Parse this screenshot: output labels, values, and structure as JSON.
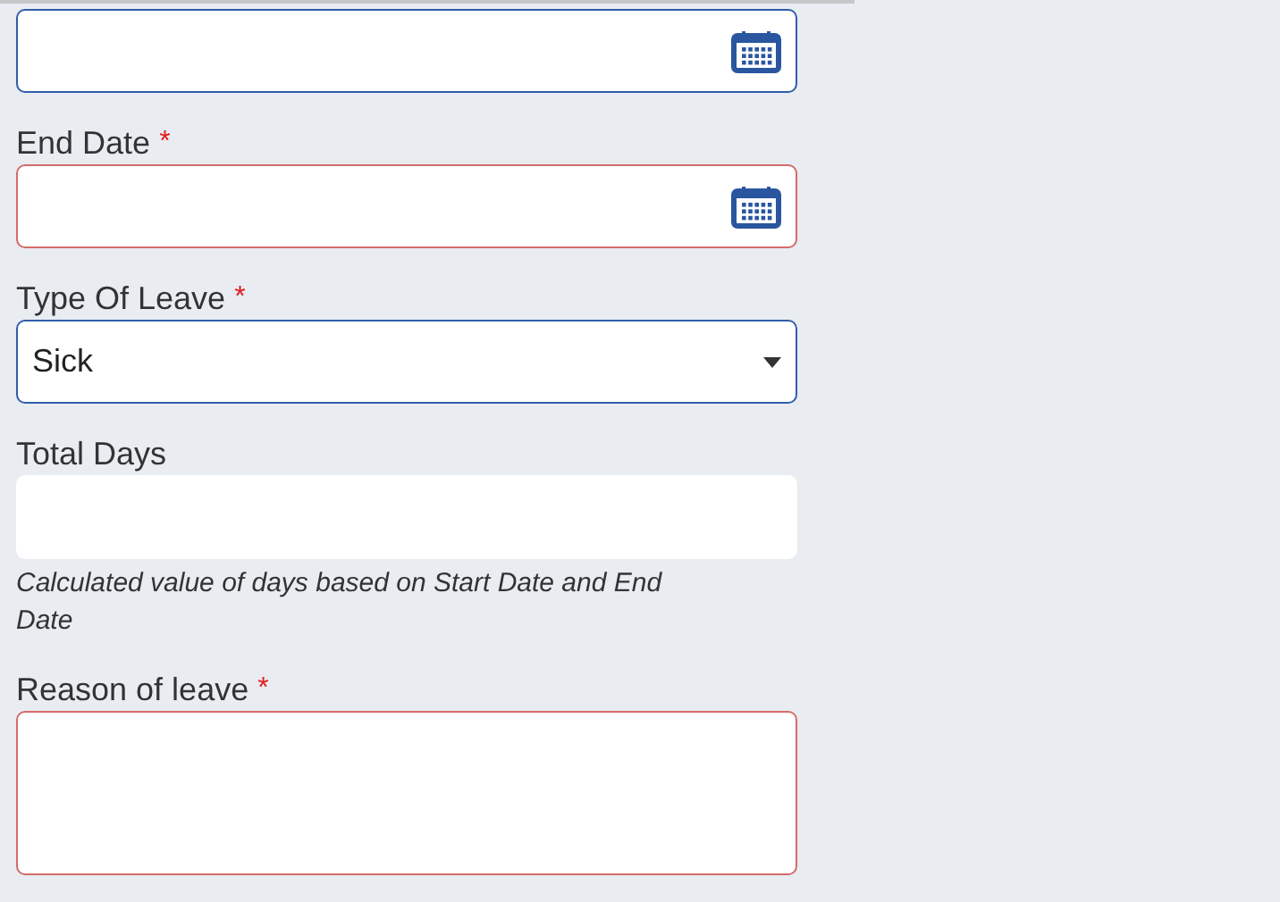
{
  "fields": [
    {
      "kind": "date",
      "invalid": false,
      "focused": true
    },
    {
      "kind": "date",
      "label": "End Date",
      "required": true,
      "invalid": true
    },
    {
      "kind": "select",
      "label": "Type Of Leave",
      "required": true,
      "invalid": false,
      "focused": true,
      "value": "Sick"
    },
    {
      "kind": "readonly",
      "label": "Total Days",
      "required": false,
      "invalid": false,
      "focused": false,
      "help": "Calculated value of days based on Start Date and End Date"
    },
    {
      "kind": "textarea",
      "label": "Reason of leave",
      "required": true,
      "invalid": true
    }
  ],
  "required_mark": "*"
}
